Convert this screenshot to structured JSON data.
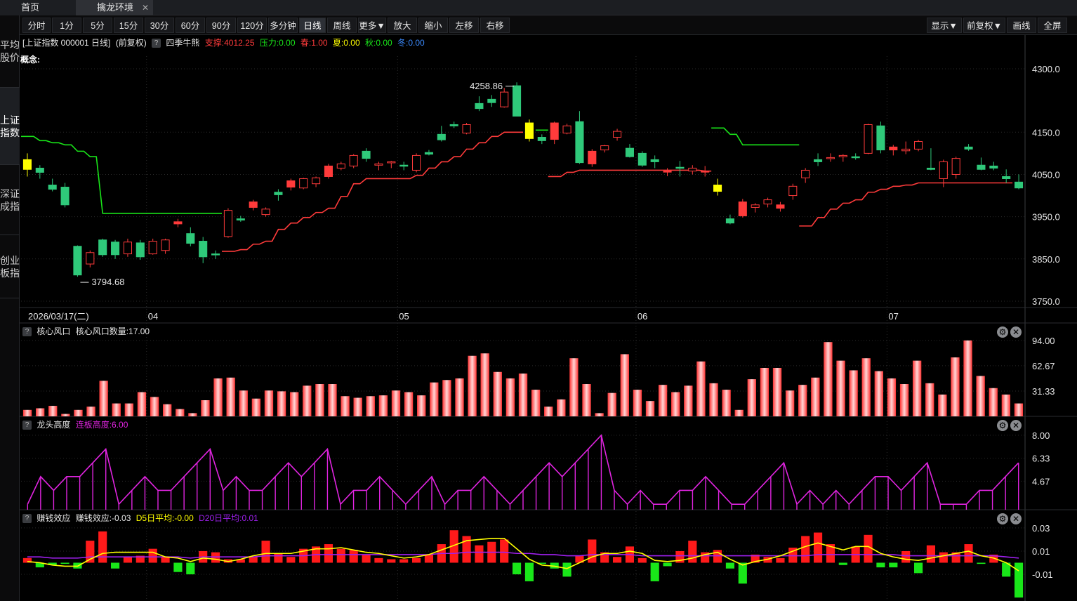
{
  "tabs": {
    "home": "首页",
    "env": "擒龙环境",
    "close": "✕"
  },
  "sidebar": [
    "平均股价",
    "上证指数",
    "深证成指",
    "创业板指"
  ],
  "toolbar": {
    "left": [
      "分时",
      "1分",
      "5分",
      "15分",
      "30分",
      "60分",
      "90分",
      "120分",
      "多分钟",
      "日线",
      "周线",
      "更多▼",
      "放大",
      "缩小",
      "左移",
      "右移"
    ],
    "active": "日线",
    "right": [
      "显示▼",
      "前复权▼",
      "画线",
      "全屏"
    ]
  },
  "main_header": {
    "title": "[上证指数 000001 日线]",
    "adjust": "(前复权)",
    "indicator": "四季牛熊",
    "support": "支撑:4012.25",
    "pressure": "压力:0.00",
    "spring": "春:1.00",
    "summer": "夏:0.00",
    "autumn": "秋:0.00",
    "winter": "冬:0.00",
    "concept": "概念:"
  },
  "colors": {
    "up": "#ff3b3b",
    "down": "#2fc97a",
    "yellow": "#ffff00",
    "green_line": "#19e619",
    "magenta": "#e024e0",
    "purple": "#a020f0",
    "bg": "#000000"
  },
  "annotations": {
    "high": "4258.86",
    "low": "3794.68"
  },
  "dates": {
    "first": "2026/03/17(二)",
    "months": [
      "04",
      "05",
      "06",
      "07"
    ]
  },
  "price_axis": [
    "4300.0",
    "4150.0",
    "4050.0",
    "3950.0",
    "3850.0",
    "3750.0"
  ],
  "panels": {
    "p1": {
      "name": "核心风口",
      "value": "核心风口数量:17.00",
      "axis": [
        "94.00",
        "62.67",
        "31.33"
      ]
    },
    "p2": {
      "name": "龙头高度",
      "value": "连板高度:6.00",
      "axis": [
        "8.00",
        "6.33",
        "4.67"
      ]
    },
    "p3": {
      "name": "赚钱效应",
      "value": "赚钱效应:-0.03",
      "d5": "D5日平均:-0.00",
      "d20": "D20日平均:0.01",
      "axis": [
        "0.03",
        "0.01",
        "-0.01"
      ]
    }
  },
  "chart_data": {
    "type": "candlestick",
    "candles_ohlc": [
      [
        4085,
        4100,
        4045,
        4062
      ],
      [
        4065,
        4072,
        4040,
        4055
      ],
      [
        4025,
        4040,
        4010,
        4015
      ],
      [
        4020,
        4030,
        3972,
        3978
      ],
      [
        3880,
        3882,
        3808,
        3812
      ],
      [
        3838,
        3870,
        3830,
        3865
      ],
      [
        3895,
        3898,
        3855,
        3860
      ],
      [
        3890,
        3895,
        3850,
        3860
      ],
      [
        3862,
        3898,
        3855,
        3890
      ],
      [
        3888,
        3895,
        3848,
        3855
      ],
      [
        3862,
        3898,
        3860,
        3892
      ],
      [
        3870,
        3898,
        3862,
        3895
      ],
      [
        3933,
        3945,
        3925,
        3938
      ],
      [
        3910,
        3925,
        3880,
        3887
      ],
      [
        3892,
        3902,
        3840,
        3855
      ],
      [
        3862,
        3870,
        3850,
        3860
      ],
      [
        3903,
        3970,
        3900,
        3965
      ],
      [
        3945,
        3952,
        3938,
        3942
      ],
      [
        3972,
        3990,
        3965,
        3985
      ],
      [
        3955,
        3972,
        3950,
        3968
      ],
      [
        4008,
        4015,
        3988,
        4002
      ],
      [
        4020,
        4040,
        4012,
        4035
      ],
      [
        4018,
        4042,
        4015,
        4040
      ],
      [
        4028,
        4045,
        4020,
        4042
      ],
      [
        4045,
        4075,
        4040,
        4070
      ],
      [
        4065,
        4080,
        4060,
        4075
      ],
      [
        4070,
        4098,
        4065,
        4095
      ],
      [
        4105,
        4112,
        4080,
        4088
      ],
      [
        4072,
        4080,
        4060,
        4075
      ],
      [
        4078,
        4082,
        4065,
        4080
      ],
      [
        4072,
        4080,
        4060,
        4070
      ],
      [
        4060,
        4100,
        4055,
        4095
      ],
      [
        4102,
        4108,
        4095,
        4098
      ],
      [
        4145,
        4165,
        4128,
        4132
      ],
      [
        4168,
        4175,
        4160,
        4165
      ],
      [
        4148,
        4172,
        4145,
        4168
      ],
      [
        4218,
        4235,
        4200,
        4206
      ],
      [
        4228,
        4238,
        4210,
        4220
      ],
      [
        4210,
        4255,
        4208,
        4245
      ],
      [
        4260,
        4268,
        4188,
        4188
      ],
      [
        4172,
        4180,
        4128,
        4135
      ],
      [
        4138,
        4145,
        4122,
        4130
      ],
      [
        4133,
        4175,
        4122,
        4172
      ],
      [
        4148,
        4170,
        4145,
        4165
      ],
      [
        4175,
        4200,
        4075,
        4078
      ],
      [
        4075,
        4110,
        4068,
        4105
      ],
      [
        4108,
        4120,
        4102,
        4118
      ],
      [
        4138,
        4158,
        4130,
        4152
      ],
      [
        4112,
        4122,
        4090,
        4092
      ],
      [
        4100,
        4105,
        4068,
        4072
      ],
      [
        4085,
        4095,
        4065,
        4080
      ],
      [
        4058,
        4065,
        4046,
        4058
      ],
      [
        4067,
        4082,
        4045,
        4066
      ],
      [
        4058,
        4072,
        4050,
        4065
      ],
      [
        4058,
        4070,
        4045,
        4058
      ],
      [
        4010,
        4040,
        4000,
        4025
      ],
      [
        3945,
        3955,
        3932,
        3935
      ],
      [
        3952,
        3992,
        3948,
        3985
      ],
      [
        3972,
        3982,
        3960,
        3978
      ],
      [
        3980,
        3995,
        3972,
        3990
      ],
      [
        3970,
        3985,
        3962,
        3978
      ],
      [
        4000,
        4028,
        3990,
        4022
      ],
      [
        4042,
        4065,
        4030,
        4060
      ],
      [
        4085,
        4100,
        4070,
        4080
      ],
      [
        4088,
        4100,
        4080,
        4090
      ],
      [
        4092,
        4098,
        4080,
        4095
      ],
      [
        4092,
        4100,
        4085,
        4090
      ],
      [
        4100,
        4170,
        4098,
        4168
      ],
      [
        4165,
        4175,
        4100,
        4108
      ],
      [
        4108,
        4120,
        4095,
        4115
      ],
      [
        4106,
        4128,
        4098,
        4110
      ],
      [
        4110,
        4132,
        4105,
        4128
      ],
      [
        4065,
        4112,
        4060,
        4062
      ],
      [
        4040,
        4085,
        4020,
        4080
      ],
      [
        4050,
        4092,
        4040,
        4088
      ],
      [
        4115,
        4122,
        4106,
        4110
      ],
      [
        4072,
        4090,
        4060,
        4062
      ],
      [
        4070,
        4080,
        4060,
        4065
      ],
      [
        4045,
        4062,
        4030,
        4040
      ],
      [
        4032,
        4050,
        4015,
        4018
      ]
    ],
    "support_line": [
      4140,
      4130,
      4125,
      4120,
      4105,
      4092,
      3958,
      3958,
      3958,
      3958,
      3958,
      3958,
      3958,
      3958,
      3958,
      3958,
      null,
      null,
      null,
      null,
      null,
      null,
      null,
      null,
      null,
      null,
      null,
      null,
      null,
      null,
      null,
      null,
      null,
      null,
      null,
      null,
      null,
      null,
      null,
      null,
      null,
      4155,
      null,
      null,
      null,
      null,
      null,
      null,
      null,
      null,
      null,
      null,
      null,
      null,
      null,
      4160,
      4145,
      4120,
      4120,
      4120,
      4120,
      4120,
      null,
      null,
      null,
      null,
      null,
      null,
      null,
      null,
      null,
      null,
      null,
      null,
      null,
      null,
      null,
      null,
      null,
      null
    ],
    "resistance_line": [
      null,
      null,
      null,
      null,
      null,
      null,
      null,
      null,
      null,
      null,
      null,
      null,
      null,
      null,
      null,
      null,
      3868,
      3872,
      3885,
      3892,
      3920,
      3935,
      3948,
      3960,
      3970,
      3998,
      4028,
      4040,
      4040,
      4040,
      4040,
      4048,
      4065,
      4080,
      4092,
      4110,
      4125,
      4140,
      4150,
      4150,
      null,
      null,
      4045,
      4055,
      4060,
      4060,
      4060,
      4060,
      4060,
      4060,
      4060,
      4060,
      4060,
      4060,
      4058,
      null,
      null,
      null,
      null,
      null,
      null,
      null,
      3928,
      3948,
      3968,
      3982,
      3990,
      4008,
      4015,
      4022,
      4025,
      4030,
      4030,
      4030,
      4030,
      4030,
      4030,
      4030,
      4030,
      null
    ],
    "core_count": [
      8,
      10,
      13,
      3,
      8,
      12,
      44,
      16,
      16,
      30,
      24,
      15,
      9,
      4,
      20,
      47,
      48,
      32,
      22,
      32,
      31,
      30,
      38,
      40,
      40,
      25,
      23,
      25,
      26,
      32,
      30,
      26,
      42,
      45,
      47,
      75,
      78,
      55,
      47,
      53,
      33,
      12,
      21,
      72,
      40,
      4,
      29,
      77,
      33,
      19,
      39,
      30,
      38,
      68,
      41,
      33,
      8,
      46,
      60,
      60,
      32,
      39,
      48,
      92,
      69,
      57,
      72,
      56,
      47,
      40,
      69,
      41,
      27,
      73,
      94,
      50,
      35,
      27,
      16
    ],
    "dragon_height": [
      3,
      5,
      4,
      5,
      5,
      6,
      7,
      3,
      4,
      5,
      4,
      4,
      5,
      6,
      7,
      4,
      5,
      4,
      4,
      5,
      6,
      5,
      6,
      7,
      3,
      4,
      4,
      5,
      4,
      3,
      4,
      5,
      3,
      4,
      4,
      5,
      4,
      3,
      4,
      5,
      6,
      5,
      6,
      7,
      8,
      4,
      3,
      4,
      3,
      3,
      4,
      4,
      5,
      4,
      3,
      3,
      4,
      5,
      6,
      3,
      4,
      3,
      4,
      3,
      4,
      5,
      5,
      4,
      5,
      6,
      3,
      3,
      3,
      4,
      4,
      5,
      6
    ],
    "money_effect": [
      0.004,
      -0.004,
      -0.002,
      -0.001,
      -0.005,
      0.019,
      0.027,
      -0.005,
      0.005,
      0.006,
      0.012,
      0.005,
      -0.008,
      -0.01,
      0.01,
      0.009,
      0.003,
      0.003,
      0.005,
      0.019,
      0.008,
      0.005,
      0.012,
      0.014,
      0.016,
      0.012,
      0.011,
      0.007,
      0.004,
      0.003,
      0.003,
      0.004,
      0.007,
      0.016,
      0.028,
      0.023,
      0.015,
      0.018,
      0.02,
      -0.01,
      -0.016,
      -0.001,
      -0.005,
      -0.012,
      0.006,
      0.02,
      0.009,
      0.005,
      0.014,
      0.004,
      -0.016,
      -0.003,
      0.01,
      0.019,
      0.009,
      0.011,
      -0.005,
      -0.018,
      0.007,
      0.005,
      0.004,
      0.013,
      0.023,
      0.026,
      0.016,
      -0.002,
      0.014,
      0.024,
      -0.004,
      -0.004,
      0.01,
      -0.009,
      0.015,
      0.009,
      0.009,
      0.016,
      -0.001,
      0.007,
      -0.012,
      -0.03
    ],
    "d5_avg": [
      0.001,
      0.0,
      -0.002,
      -0.003,
      -0.003,
      0.003,
      0.008,
      0.009,
      0.009,
      0.009,
      0.009,
      0.005,
      0.004,
      0.001,
      0.004,
      0.003,
      0.001,
      0.003,
      0.006,
      0.008,
      0.008,
      0.008,
      0.01,
      0.012,
      0.012,
      0.013,
      0.011,
      0.009,
      0.008,
      0.006,
      0.004,
      0.005,
      0.007,
      0.011,
      0.015,
      0.019,
      0.02,
      0.021,
      0.021,
      0.012,
      0.003,
      -0.002,
      -0.003,
      -0.005,
      0.0,
      0.005,
      0.008,
      0.008,
      0.01,
      0.008,
      0.002,
      0.001,
      0.002,
      0.004,
      0.007,
      0.009,
      0.003,
      -0.002,
      0.001,
      0.003,
      0.006,
      0.01,
      0.014,
      0.017,
      0.014,
      0.011,
      0.014,
      0.014,
      0.008,
      0.005,
      0.003,
      0.002,
      0.004,
      0.006,
      0.008,
      0.01,
      0.006,
      0.004,
      0.0,
      -0.007
    ],
    "d20_avg": [
      0.005,
      0.005,
      0.004,
      0.004,
      0.004,
      0.005,
      0.005,
      0.005,
      0.005,
      0.005,
      0.005,
      0.005,
      0.005,
      0.004,
      0.005,
      0.005,
      0.005,
      0.005,
      0.005,
      0.006,
      0.006,
      0.006,
      0.006,
      0.007,
      0.007,
      0.007,
      0.007,
      0.007,
      0.007,
      0.007,
      0.007,
      0.007,
      0.007,
      0.008,
      0.008,
      0.009,
      0.009,
      0.009,
      0.009,
      0.008,
      0.008,
      0.007,
      0.007,
      0.006,
      0.006,
      0.007,
      0.007,
      0.007,
      0.007,
      0.006,
      0.006,
      0.006,
      0.006,
      0.006,
      0.006,
      0.006,
      0.006,
      0.006,
      0.006,
      0.006,
      0.006,
      0.006,
      0.006,
      0.007,
      0.007,
      0.007,
      0.007,
      0.007,
      0.007,
      0.007,
      0.006,
      0.006,
      0.006,
      0.006,
      0.006,
      0.006,
      0.006,
      0.006,
      0.005,
      0.004
    ]
  }
}
